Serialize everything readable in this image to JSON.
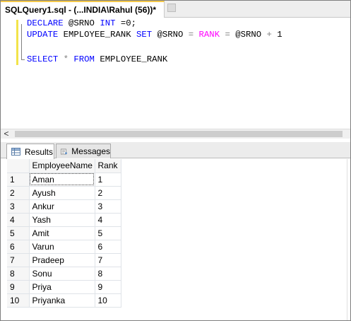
{
  "window": {
    "tab_title": "SQLQuery1.sql - (...INDIA\\Rahul (56))*"
  },
  "editor": {
    "line1": {
      "kw1": "DECLARE",
      "var": " @SRNO ",
      "kw2": "INT",
      "rest": " =0;"
    },
    "line2": {
      "kw1": "UPDATE",
      "tbl": " EMPLOYEE_RANK ",
      "kw2": "SET",
      "var1": " @SRNO ",
      "eq1": "=",
      "fn": " RANK ",
      "eq2": "=",
      "var2": " @SRNO ",
      "plus": "+",
      "num": " 1"
    },
    "line4": {
      "kw1": "SELECT",
      "star": " * ",
      "kw2": "FROM",
      "tbl": " EMPLOYEE_RANK"
    }
  },
  "scrollbar": {
    "left_arrow": "<"
  },
  "results_tabs": [
    {
      "label": "Results",
      "icon": "grid-icon"
    },
    {
      "label": "Messages",
      "icon": "messages-icon"
    }
  ],
  "grid": {
    "columns": [
      "",
      "EmployeeName",
      "Rank"
    ],
    "rows": [
      [
        "1",
        "Aman",
        "1"
      ],
      [
        "2",
        "Ayush",
        "2"
      ],
      [
        "3",
        "Ankur",
        "3"
      ],
      [
        "4",
        "Yash",
        "4"
      ],
      [
        "5",
        "Amit",
        "5"
      ],
      [
        "6",
        "Varun",
        "6"
      ],
      [
        "7",
        "Pradeep",
        "7"
      ],
      [
        "8",
        "Sonu",
        "8"
      ],
      [
        "9",
        "Priya",
        "9"
      ],
      [
        "10",
        "Priyanka",
        "10"
      ]
    ]
  },
  "colors": {
    "keyword": "#0000ff",
    "function": "#ff00ff",
    "tab_accent": "#f4c84a"
  }
}
